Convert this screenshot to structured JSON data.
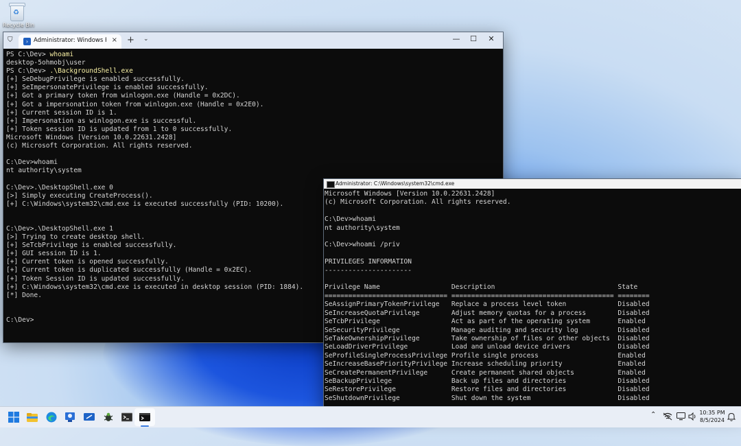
{
  "desktop": {
    "recycle_bin_label": "Recycle Bin"
  },
  "terminal": {
    "tab_title": "Administrator: Windows PowerShell",
    "prompt_1": "PS C:\\Dev> ",
    "cmd_1": "whoami",
    "output_1": "desktop-5ohmobj\\user",
    "prompt_2": "PS C:\\Dev> ",
    "cmd_2": ".\\BackgroundShell.exe",
    "output_2": "[+] SeDebugPrivilege is enabled successfully.\n[+] SeImpersonatePrivilege is enabled successfully.\n[+] Got a primary token from winlogon.exe (Handle = 0x2DC).\n[+] Got a impersonation token from winlogon.exe (Handle = 0x2E0).\n[+] Current session ID is 1.\n[+] Impersonation as winlogon.exe is successful.\n[+] Token session ID is updated from 1 to 0 successfully.\nMicrosoft Windows [Version 10.0.22631.2428]\n(c) Microsoft Corporation. All rights reserved.\n\nC:\\Dev>whoami\nnt authority\\system\n\nC:\\Dev>.\\DesktopShell.exe 0\n[>] Simply executing CreateProcess().\n[+] C:\\Windows\\system32\\cmd.exe is executed successfully (PID: 10200).\n\n\nC:\\Dev>.\\DesktopShell.exe 1\n[>] Trying to create desktop shell.\n[+] SeTcbPrivilege is enabled successfully.\n[+] GUI session ID is 1.\n[+] Current token is opened successfully.\n[+] Current token is duplicated successfully (Handle = 0x2EC).\n[+] Token Session ID is updated successfully.\n[+] C:\\Windows\\system32\\cmd.exe is executed in desktop session (PID: 1884).\n[*] Done.\n\n\nC:\\Dev>"
  },
  "cmd_window": {
    "title": "Administrator: C:\\Windows\\system32\\cmd.exe",
    "content": "Microsoft Windows [Version 10.0.22631.2428]\n(c) Microsoft Corporation. All rights reserved.\n\nC:\\Dev>whoami\nnt authority\\system\n\nC:\\Dev>whoami /priv\n\nPRIVILEGES INFORMATION\n----------------------\n\nPrivilege Name                  Description                               State\n=============================== ========================================= ========\nSeAssignPrimaryTokenPrivilege   Replace a process level token             Disabled\nSeIncreaseQuotaPrivilege        Adjust memory quotas for a process        Disabled\nSeTcbPrivilege                  Act as part of the operating system       Enabled\nSeSecurityPrivilege             Manage auditing and security log          Disabled\nSeTakeOwnershipPrivilege        Take ownership of files or other objects  Disabled\nSeLoadDriverPrivilege           Load and unload device drivers            Disabled\nSeProfileSingleProcessPrivilege Profile single process                    Enabled\nSeIncreaseBasePriorityPrivilege Increase scheduling priority              Enabled\nSeCreatePermanentPrivilege      Create permanent shared objects           Enabled\nSeBackupPrivilege               Back up files and directories             Disabled\nSeRestorePrivilege              Restore files and directories             Disabled\nSeShutdownPrivilege             Shut down the system                      Disabled"
  },
  "taskbar": {
    "clock_time": "10:35 PM",
    "clock_date": "8/5/2024",
    "icons": [
      "windows-start-icon",
      "file-explorer-icon",
      "edge-browser-icon",
      "magnifier-app-icon",
      "remote-desktop-icon",
      "bug-debugger-icon",
      "console-icon",
      "terminal-icon"
    ]
  },
  "colors": {
    "terminal_bg": "#0c0c0c",
    "terminal_text": "#d6d6d6",
    "ps_command": "#f9f1a5",
    "accent": "#3a7be0"
  }
}
